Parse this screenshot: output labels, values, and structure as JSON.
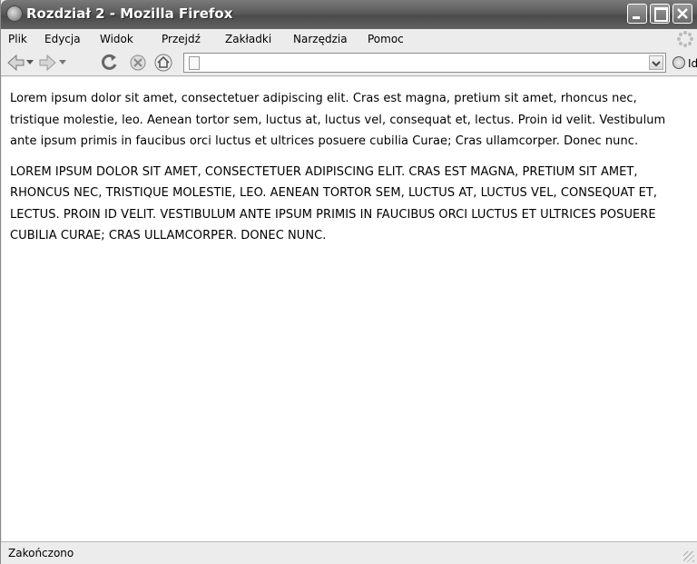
{
  "window": {
    "title": "Rozdział 2 - Mozilla Firefox"
  },
  "menu": [
    {
      "label": "Plik",
      "name": "menu-plik"
    },
    {
      "label": "Edycja",
      "name": "menu-edycja"
    },
    {
      "label": "Widok",
      "name": "menu-widok"
    },
    {
      "label": "Przejdź",
      "name": "menu-przejdz"
    },
    {
      "label": "Zakładki",
      "name": "menu-zakladki"
    },
    {
      "label": "Narzędzia",
      "name": "menu-narzedzia"
    },
    {
      "label": "Pomoc",
      "name": "menu-pomoc"
    }
  ],
  "toolbar": {
    "icons": [
      "back-icon",
      "forward-icon",
      "reload-icon",
      "stop-icon",
      "home-icon"
    ],
    "url_value": "",
    "go_label": "Idź"
  },
  "content": {
    "paragraph1": "Lorem ipsum dolor sit amet, consectetuer adipiscing elit. Cras est magna, pretium sit amet, rhoncus nec, tristique molestie, leo. Aenean tortor sem, luctus at, luctus vel, consequat et, lectus. Proin id velit. Vestibulum ante ipsum primis in faucibus orci luctus et ultrices posuere cubilia Curae; Cras ullamcorper. Donec nunc.",
    "paragraph2": "LOREM IPSUM DOLOR SIT AMET, CONSECTETUER ADIPISCING ELIT. CRAS EST MAGNA, PRETIUM SIT AMET, RHONCUS NEC, TRISTIQUE MOLESTIE, LEO. AENEAN TORTOR SEM, LUCTUS AT, LUCTUS VEL, CONSEQUAT ET, LECTUS. PROIN ID VELIT. VESTIBULUM ANTE IPSUM PRIMIS IN FAUCIBUS ORCI LUCTUS ET ULTRICES POSUERE CUBILIA CURAE; CRAS ULLAMCORPER. DONEC NUNC."
  },
  "status": {
    "text": "Zakończono"
  }
}
